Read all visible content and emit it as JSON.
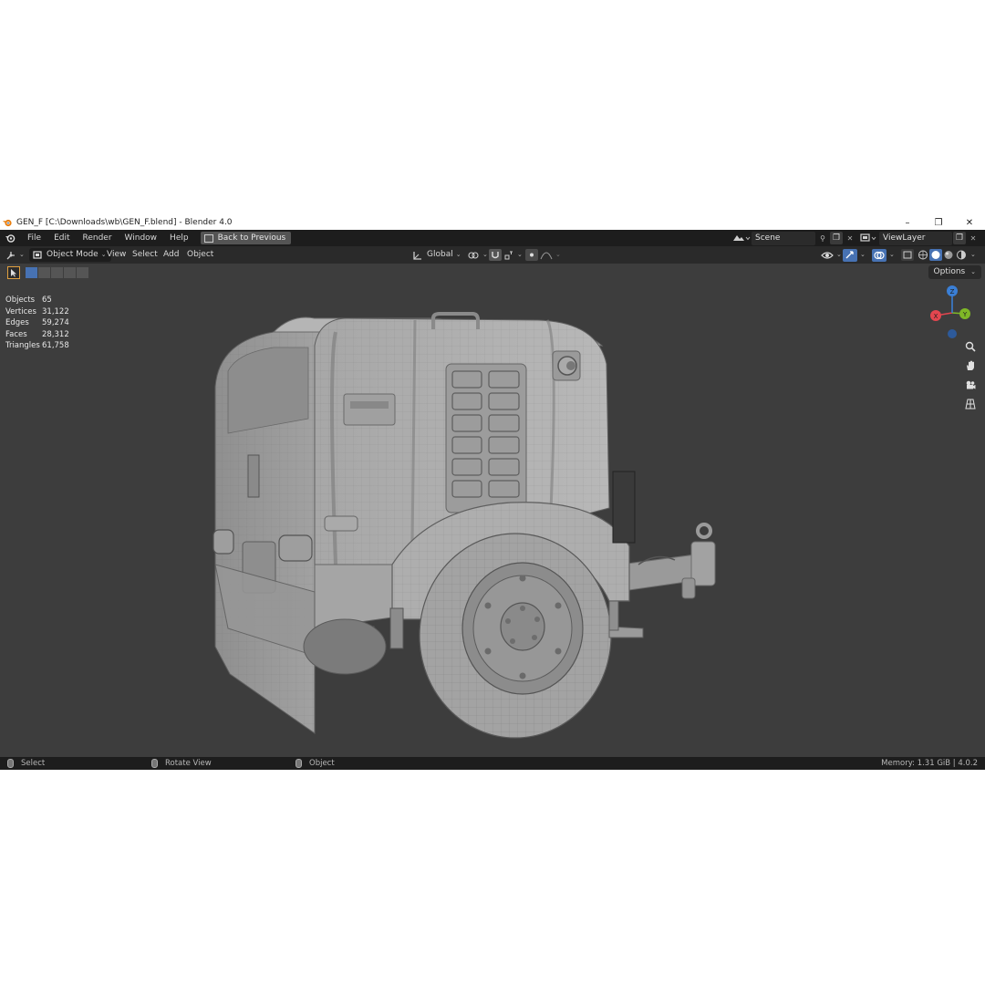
{
  "window": {
    "title": "GEN_F [C:\\Downloads\\wb\\GEN_F.blend] - Blender 4.0",
    "controls": [
      "–",
      "❐",
      "✕"
    ]
  },
  "topbar": {
    "menus": [
      "File",
      "Edit",
      "Render",
      "Window",
      "Help"
    ],
    "back_label": "Back to Previous",
    "scene": "Scene",
    "view_layer": "ViewLayer"
  },
  "header": {
    "mode": "Object Mode",
    "menus": [
      "View",
      "Select",
      "Add",
      "Object"
    ],
    "orientation": "Global"
  },
  "viewport": {
    "options_label": "Options",
    "stats": [
      {
        "label": "Objects",
        "value": "65"
      },
      {
        "label": "Vertices",
        "value": "31,122"
      },
      {
        "label": "Edges",
        "value": "59,274"
      },
      {
        "label": "Faces",
        "value": "28,312"
      },
      {
        "label": "Triangles",
        "value": "61,758"
      }
    ],
    "gizmo": {
      "x": "X",
      "y": "Y",
      "z": "Z"
    },
    "nav_icons": [
      "zoom-icon",
      "pan-hand-icon",
      "camera-icon",
      "grid-icon"
    ]
  },
  "statusbar": {
    "select": "Select",
    "rotate": "Rotate View",
    "object": "Object",
    "memory": "Memory: 1.31 GiB | 4.0.2"
  },
  "colors": {
    "accent_blue": "#4772b3",
    "axis_x": "#e3464f",
    "axis_y": "#7fb827",
    "axis_z": "#3a7fd6",
    "viewport_bg": "#3d3d3d",
    "select_outline": "#e0a040"
  }
}
